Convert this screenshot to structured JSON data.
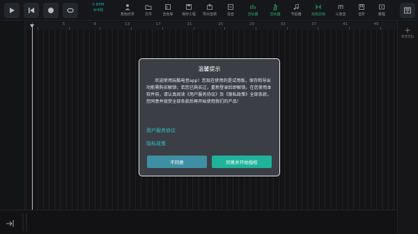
{
  "toolbar": {
    "bpm_value": "0 BPM",
    "time_signature": "4/4拍",
    "tools": [
      {
        "label": "角色欣赏",
        "icon": "person-icon"
      },
      {
        "label": "文件",
        "icon": "folder-icon"
      },
      {
        "label": "音色库",
        "icon": "sound-library-icon"
      },
      {
        "label": "保存工程",
        "icon": "save-icon"
      },
      {
        "label": "导出音频",
        "icon": "export-icon"
      },
      {
        "label": "混音",
        "icon": "mix-icon"
      },
      {
        "label": "音轨器",
        "icon": "track-icon"
      },
      {
        "label": "音轨器",
        "icon": "metronome-icon"
      },
      {
        "label": "节拍器",
        "icon": "beat-icon"
      },
      {
        "label": "高级剪辑",
        "icon": "edit-icon"
      },
      {
        "label": "三连音",
        "icon": "triplet-icon"
      },
      {
        "label": "音阶",
        "icon": "piano-icon"
      },
      {
        "label": "教程",
        "icon": "tutorial-icon"
      }
    ]
  },
  "ruler": {
    "marks": [
      "1",
      "5",
      "9",
      "13",
      "17",
      "21",
      "25",
      "29",
      "33",
      "37",
      "41",
      "45"
    ]
  },
  "right_panel": {
    "add_track_label": "新建音轨"
  },
  "dialog": {
    "title": "温馨提示",
    "body": "欢迎使用玩酷电音app！您现在使用的是试用版，保存和导出功能需购买解锁；若您已购买过，重新登录后即解锁。在您使用本软件前，请认真阅读《用户服务协议》及《隐私政策》全部条款，您同意并接受全部条款后再开始使用我们的产品！",
    "link_user_agreement": "用户服务协议",
    "link_privacy": "隐私政策",
    "btn_disagree": "不同意",
    "btn_agree": "同意并开始授权"
  },
  "colors": {
    "accent_teal": "#2fc4c4",
    "accent_green": "#36c57d",
    "agree_button": "#1fb39a",
    "disagree_button": "#3f8fa4"
  }
}
